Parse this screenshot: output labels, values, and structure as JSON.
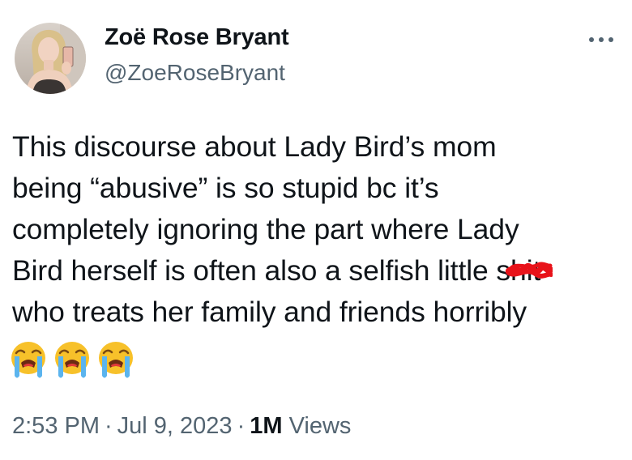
{
  "author": {
    "name": "Zoë Rose Bryant",
    "handle": "@ZoeRoseBryant"
  },
  "menu": {
    "icon": "more-horizontal-icon"
  },
  "tweet": {
    "lines": {
      "line1": "This discourse about Lady Bird’s mom",
      "line2": "being “abusive” is so stupid bc it’s",
      "line3": "completely ignoring the part where Lady",
      "line4_before": "Bird herself is often also a selfish little ",
      "line4_censored": "shit",
      "line5": "who treats her family and friends horribly"
    },
    "emojis": [
      "loudly-crying-face-emoji",
      "loudly-crying-face-emoji",
      "loudly-crying-face-emoji"
    ],
    "censor_color": "#e8131a"
  },
  "meta": {
    "time": "2:53 PM",
    "separator": "·",
    "date": "Jul 9, 2023",
    "views_count": "1M",
    "views_label": "Views"
  },
  "colors": {
    "text": "#0f1419",
    "secondary": "#536471",
    "background": "#ffffff"
  }
}
